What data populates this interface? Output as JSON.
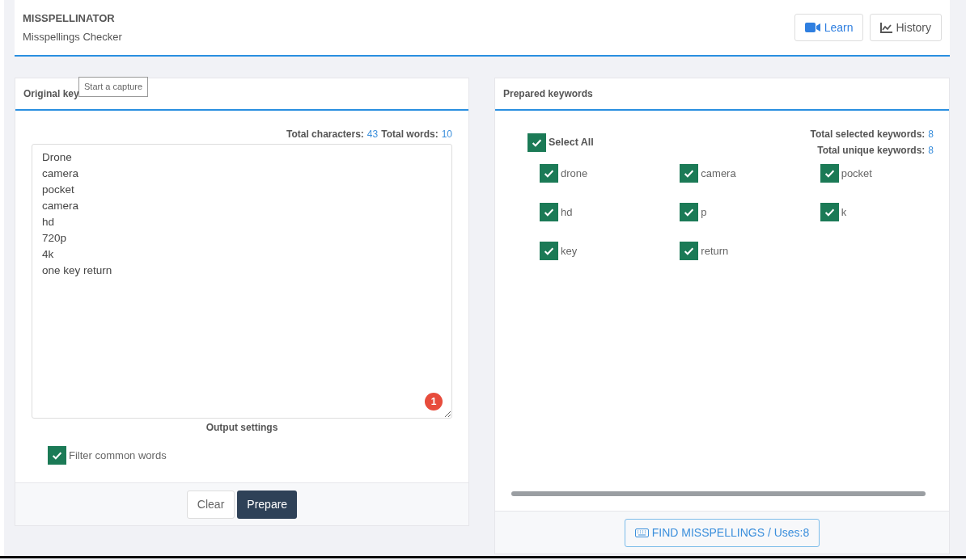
{
  "header": {
    "title": "MISSPELLINATOR",
    "subtitle": "Misspellings Checker",
    "buttons": [
      {
        "kind": "video",
        "label": "Learn"
      },
      {
        "kind": "chart",
        "label": "History"
      }
    ]
  },
  "left_card": {
    "title": "Original key",
    "tooltip": "Start a capture",
    "stats": [
      {
        "label": "Total characters:",
        "value": "43"
      },
      {
        "label": "Total words:",
        "value": "10"
      }
    ],
    "text": "Drone\ncamera\npocket\ncamera\nhd\n720p\n4k\none key return",
    "badge": "1",
    "settings_title": "Output settings",
    "filter": {
      "label": "Filter common words",
      "checked": true
    },
    "buttons": [
      {
        "kind": "light",
        "label": "Clear"
      },
      {
        "kind": "dark",
        "label": "Prepare"
      }
    ]
  },
  "right_card": {
    "title": "Prepared keywords",
    "select_all": {
      "label": "Select All",
      "checked": true
    },
    "stats": [
      {
        "label": "Total selected keywords:",
        "value": "8"
      },
      {
        "label": "Total unique keywords:",
        "value": "8"
      }
    ],
    "keywords": [
      {
        "label": "drone",
        "checked": true
      },
      {
        "label": "camera",
        "checked": true
      },
      {
        "label": "pocket",
        "checked": true
      },
      {
        "label": "hd",
        "checked": true
      },
      {
        "label": "p",
        "checked": true
      },
      {
        "label": "k",
        "checked": true
      },
      {
        "label": "key",
        "checked": true
      },
      {
        "label": "return",
        "checked": true
      }
    ],
    "action": "FIND MISSPELLINGS / Uses:8"
  }
}
